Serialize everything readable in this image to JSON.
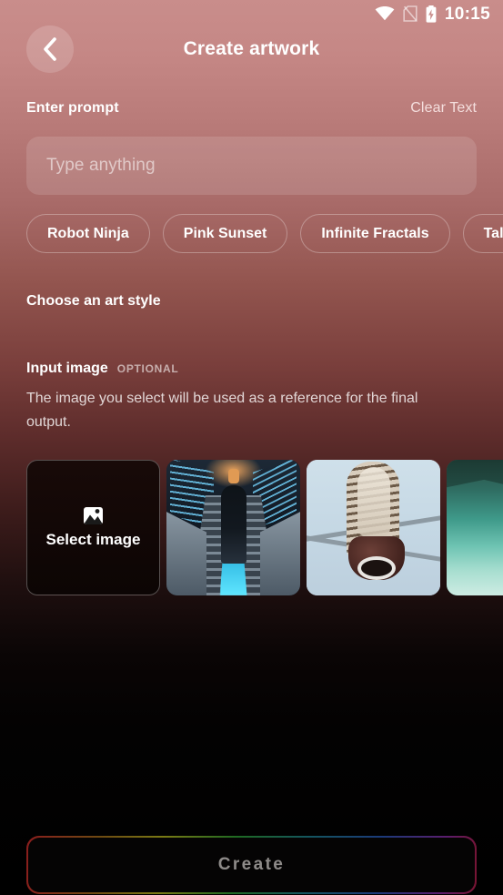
{
  "status_bar": {
    "time": "10:15",
    "icons": [
      "wifi-icon",
      "no-sim-icon",
      "battery-charging-icon"
    ]
  },
  "header": {
    "back_icon": "chevron-left-icon",
    "title": "Create artwork"
  },
  "prompt_section": {
    "label": "Enter prompt",
    "clear_label": "Clear Text",
    "input_value": "",
    "input_placeholder": "Type anything",
    "suggestions": [
      {
        "label": "Robot Ninja"
      },
      {
        "label": "Pink Sunset"
      },
      {
        "label": "Infinite Fractals"
      },
      {
        "label": "Tall Bird"
      }
    ]
  },
  "art_style_section": {
    "label": "Choose an art style"
  },
  "input_image_section": {
    "label": "Input image",
    "badge": "OPTIONAL",
    "description": "The image you select will be used as a reference for the final output.",
    "select_image": {
      "label": "Select image",
      "icon": "image-placeholder-icon"
    },
    "thumbnails": [
      {
        "name": "escalator-night-photo"
      },
      {
        "name": "owl-on-powerline-photo"
      },
      {
        "name": "turquoise-lake-boat-photo"
      }
    ]
  },
  "footer": {
    "create_label": "Create",
    "create_enabled": false,
    "gradient_border": true
  },
  "colors": {
    "background_top": "#c98d8b",
    "background_bottom": "#000000",
    "text_primary": "#ffffff",
    "text_secondary": "rgba(255,255,255,0.80)",
    "create_text": "#8e8b89"
  }
}
